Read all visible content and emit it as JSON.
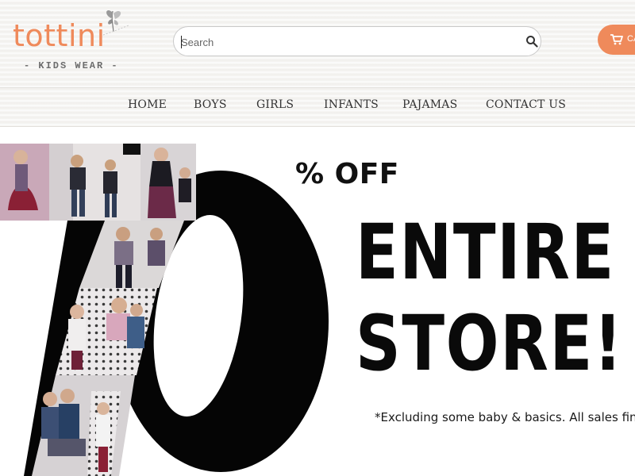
{
  "brand": {
    "name": "tottini",
    "tagline": "- KIDS WEAR -",
    "accent_color": "#ef8a5b"
  },
  "search": {
    "placeholder": "Search",
    "value": "",
    "icon": "search-icon"
  },
  "cart": {
    "label": "CA",
    "icon": "shopping-cart-icon"
  },
  "nav": {
    "items": [
      {
        "label": "HOME"
      },
      {
        "label": "BOYS"
      },
      {
        "label": "GIRLS"
      },
      {
        "label": "INFANTS"
      },
      {
        "label": "PAJAMAS"
      },
      {
        "label": "CONTACT US"
      }
    ]
  },
  "promo": {
    "percent_number": "70",
    "percent_label": "% OFF",
    "headline_line1": "ENTIRE",
    "headline_line2": "STORE!",
    "disclaimer": "*Excluding some baby & basics. All sales final."
  }
}
